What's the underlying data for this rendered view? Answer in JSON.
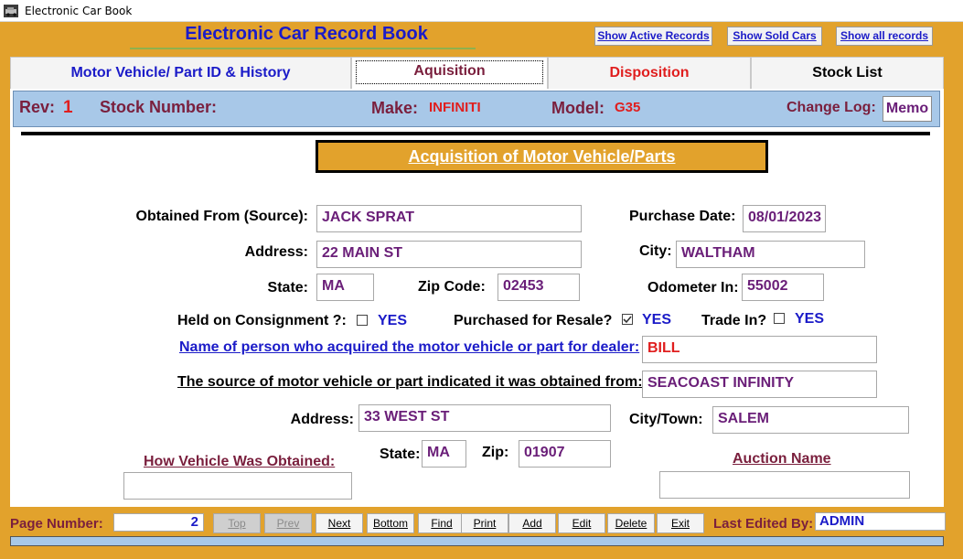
{
  "window": {
    "title": "Electronic Car Book"
  },
  "app": {
    "title": "Electronic Car Record Book"
  },
  "top_buttons": {
    "active": "Show Active Records",
    "sold": "Show Sold Cars",
    "all": "Show all records"
  },
  "tabs": [
    {
      "label": "Motor Vehicle/ Part ID & History",
      "color": "#1B1BC8"
    },
    {
      "label": "Aquisition",
      "color": "#7A1F3D"
    },
    {
      "label": "Disposition",
      "color": "#E01E1E"
    },
    {
      "label": "Stock List",
      "color": "#000000"
    }
  ],
  "header": {
    "rev_label": "Rev:",
    "rev_value": "1",
    "stock_label": "Stock Number:",
    "stock_value": "",
    "make_label": "Make:",
    "make_value": "INFINITI",
    "model_label": "Model:",
    "model_value": "G35",
    "changelog_label": "Change Log:",
    "memo_label": "Memo"
  },
  "section": {
    "title": "Acquisition of Motor Vehicle/Parts"
  },
  "form": {
    "obtained_from_label": "Obtained From (Source):",
    "obtained_from_value": "JACK SPRAT",
    "purchase_date_label": "Purchase Date:",
    "purchase_date_value": "08/01/2023",
    "address_label": "Address:",
    "address_value": "22 MAIN ST",
    "city_label": "City:",
    "city_value": "WALTHAM",
    "state_label": "State:",
    "state_value": "MA",
    "zip_label": "Zip Code:",
    "zip_value": "02453",
    "odometer_label": "Odometer In:",
    "odometer_value": "55002",
    "consignment_label": "Held on Consignment ?:",
    "consignment_checked": false,
    "consignment_yes": "YES",
    "resale_label": "Purchased for Resale?",
    "resale_checked": true,
    "resale_yes": "YES",
    "tradein_label": "Trade In?",
    "tradein_checked": false,
    "tradein_yes": "YES",
    "acquirer_label": "Name of person who acquired the motor vehicle or part for dealer:",
    "acquirer_value": "BILL",
    "source_label": "The source of motor vehicle or part indicated it was obtained from:",
    "source_value": "SEACOAST INFINITY",
    "address2_label": "Address:",
    "address2_value": "33 WEST ST",
    "citytown_label": "City/Town:",
    "citytown_value": "SALEM",
    "how_obtained_label": "How Vehicle Was Obtained:",
    "how_obtained_value": "",
    "state2_label": "State:",
    "state2_value": "MA",
    "zip2_label": "Zip:",
    "zip2_value": "01907",
    "auction_label": "Auction Name",
    "auction_value": ""
  },
  "navbar": {
    "page_label": "Page Number:",
    "page_value": "2",
    "buttons": {
      "top": "Top",
      "prev": "Prev",
      "next": "Next",
      "bottom": "Bottom",
      "find": "Find",
      "print": "Print",
      "add": "Add",
      "edit": "Edit",
      "delete": "Delete",
      "exit": "Exit"
    },
    "last_edited_label": "Last Edited By:",
    "last_edited_value": "ADMIN"
  }
}
